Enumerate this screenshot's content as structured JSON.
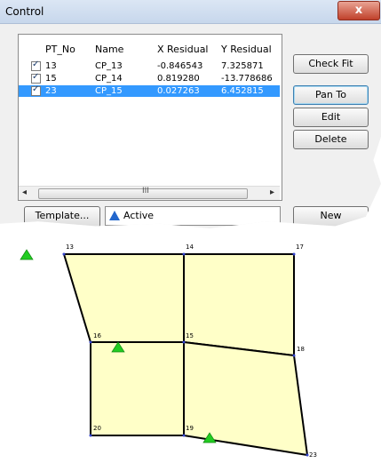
{
  "dialog": {
    "title": "Control",
    "close_glyph": "x",
    "columns": [
      "PT_No",
      "Name",
      "X Residual",
      "Y Residual"
    ],
    "rows": [
      {
        "pt": "13",
        "name": "CP_13",
        "x": "-0.846543",
        "y": "7.325871",
        "checked": true,
        "selected": false
      },
      {
        "pt": "15",
        "name": "CP_14",
        "x": "0.819280",
        "y": "-13.778686",
        "checked": true,
        "selected": false
      },
      {
        "pt": "23",
        "name": "CP_15",
        "x": "0.027263",
        "y": "6.452815",
        "checked": true,
        "selected": true
      }
    ],
    "scroll_left": "◂",
    "scroll_right": "▸",
    "scroll_grip": "III",
    "buttons": {
      "check_fit": "Check Fit",
      "pan_to": "Pan To",
      "edit": "Edit",
      "delete": "Delete"
    },
    "template_label": "Template...",
    "active_label": "Active",
    "new_label": "New"
  },
  "map": {
    "labels": {
      "p13": "13",
      "p14": "14",
      "p17": "17",
      "p16": "16",
      "p15": "15",
      "p18": "18",
      "p20": "20",
      "p19": "19",
      "p23": "23"
    },
    "fill_color": "#ffffc8",
    "marker_color": "#22cc22"
  }
}
